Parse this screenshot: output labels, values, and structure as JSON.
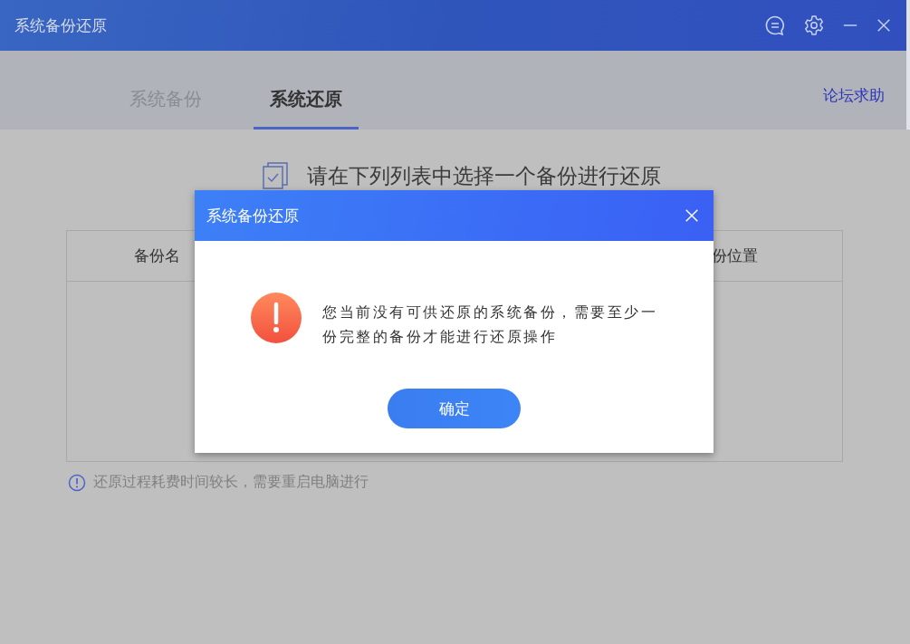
{
  "window": {
    "title": "系统备份还原"
  },
  "tabs": [
    {
      "label": "系统备份",
      "selected": false
    },
    {
      "label": "系统还原",
      "selected": true
    }
  ],
  "forum_link": "论坛求助",
  "heading": "请在下列列表中选择一个备份进行还原",
  "table": {
    "columns": [
      "备份名",
      "份位置"
    ]
  },
  "note": "还原过程耗费时间较长，需要重启电脑进行",
  "dialog": {
    "title": "系统备份还原",
    "message": "您当前没有可供还原的系统备份，需要至少一份完整的备份才能进行还原操作",
    "button": "确定"
  }
}
